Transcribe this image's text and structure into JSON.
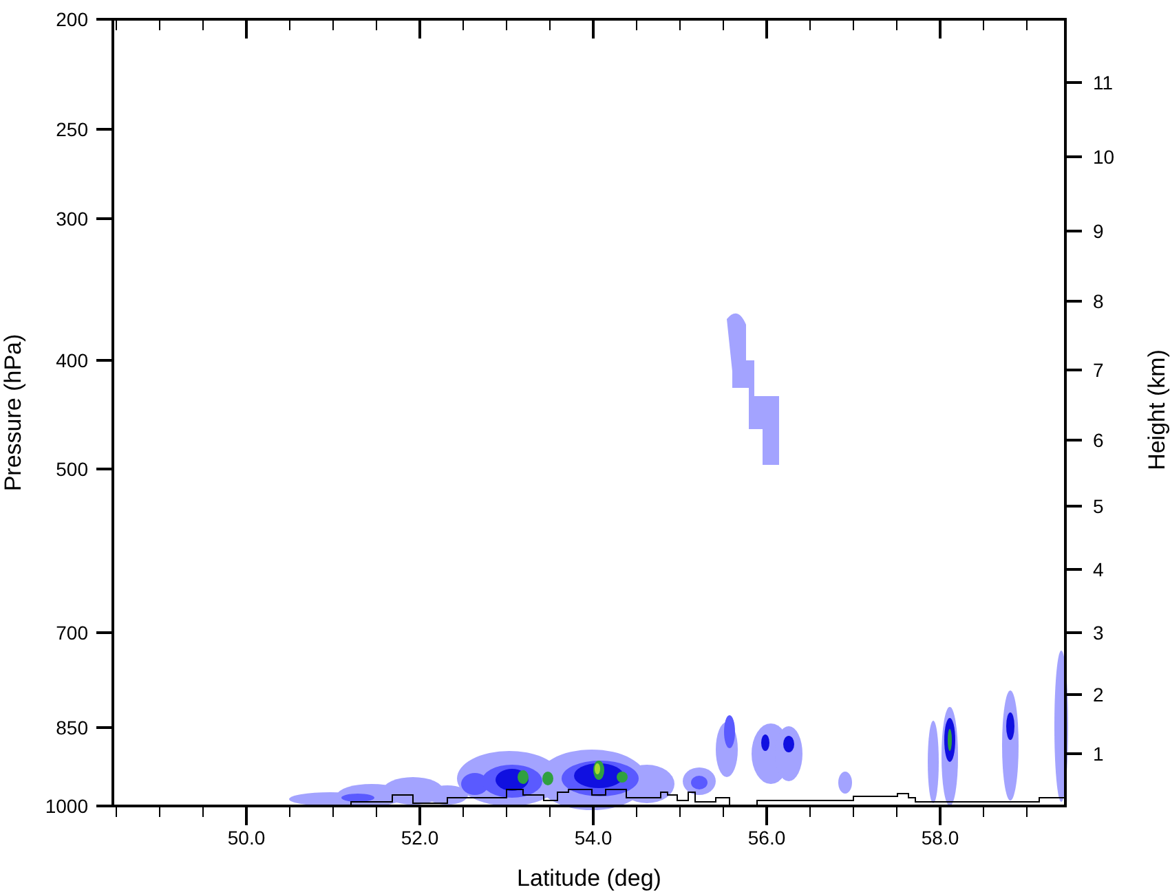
{
  "plot": {
    "left_axis": {
      "title": "Pressure (hPa)",
      "ticks": [
        "200",
        "250",
        "300",
        "400",
        "500",
        "700",
        "850",
        "1000"
      ]
    },
    "right_axis": {
      "title": "Height (km)",
      "ticks": [
        "11",
        "10",
        "9",
        "8",
        "7",
        "6",
        "5",
        "4",
        "3",
        "2",
        "1"
      ]
    },
    "bottom_axis": {
      "title": "Latitude (deg)",
      "ticks": [
        "50.0",
        "52.0",
        "54.0",
        "56.0",
        "58.0"
      ]
    }
  }
}
